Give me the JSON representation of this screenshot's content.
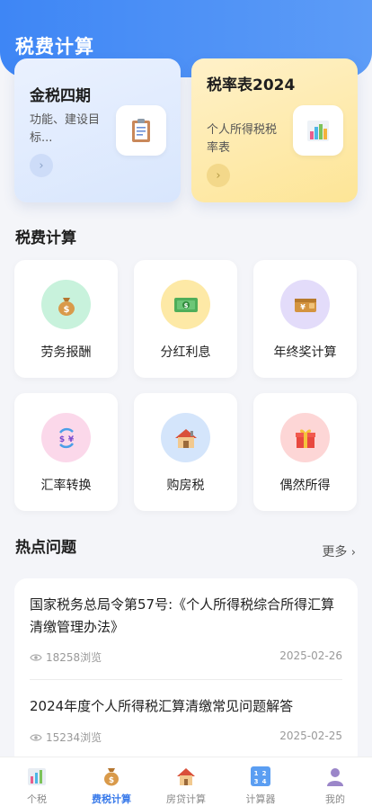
{
  "header": {
    "title": "税费计算"
  },
  "feature_cards": [
    {
      "title": "金税四期",
      "desc": "功能、建设目标...",
      "icon": "clipboard-icon"
    },
    {
      "title": "税率表2024",
      "desc": "个人所得税税率表",
      "icon": "bar-chart-icon"
    }
  ],
  "calc_section": {
    "title": "税费计算",
    "items": [
      {
        "label": "劳务报酬",
        "icon": "money-bag-icon"
      },
      {
        "label": "分红利息",
        "icon": "banknote-icon"
      },
      {
        "label": "年终奖计算",
        "icon": "wallet-icon"
      },
      {
        "label": "汇率转换",
        "icon": "currency-exchange-icon"
      },
      {
        "label": "购房税",
        "icon": "house-icon"
      },
      {
        "label": "偶然所得",
        "icon": "gift-icon"
      }
    ]
  },
  "hot_section": {
    "title": "热点问题",
    "more_label": "更多",
    "questions": [
      {
        "title": "国家税务总局令第57号:《个人所得税综合所得汇算清缴管理办法》",
        "views": "18258浏览",
        "date": "2025-02-26"
      },
      {
        "title": "2024年度个人所得税汇算清缴常见问题解答",
        "views": "15234浏览",
        "date": "2025-02-25"
      }
    ]
  },
  "tabbar": {
    "tabs": [
      {
        "label": "个税",
        "icon": "chart-icon",
        "active": false
      },
      {
        "label": "费税计算",
        "icon": "money-bag-icon",
        "active": true
      },
      {
        "label": "房贷计算",
        "icon": "house-icon",
        "active": false
      },
      {
        "label": "计算器",
        "icon": "keypad-icon",
        "active": false
      },
      {
        "label": "我的",
        "icon": "user-icon",
        "active": false
      }
    ]
  },
  "colors": {
    "primary": "#3e86f5",
    "active_tab": "#3a7bea"
  }
}
